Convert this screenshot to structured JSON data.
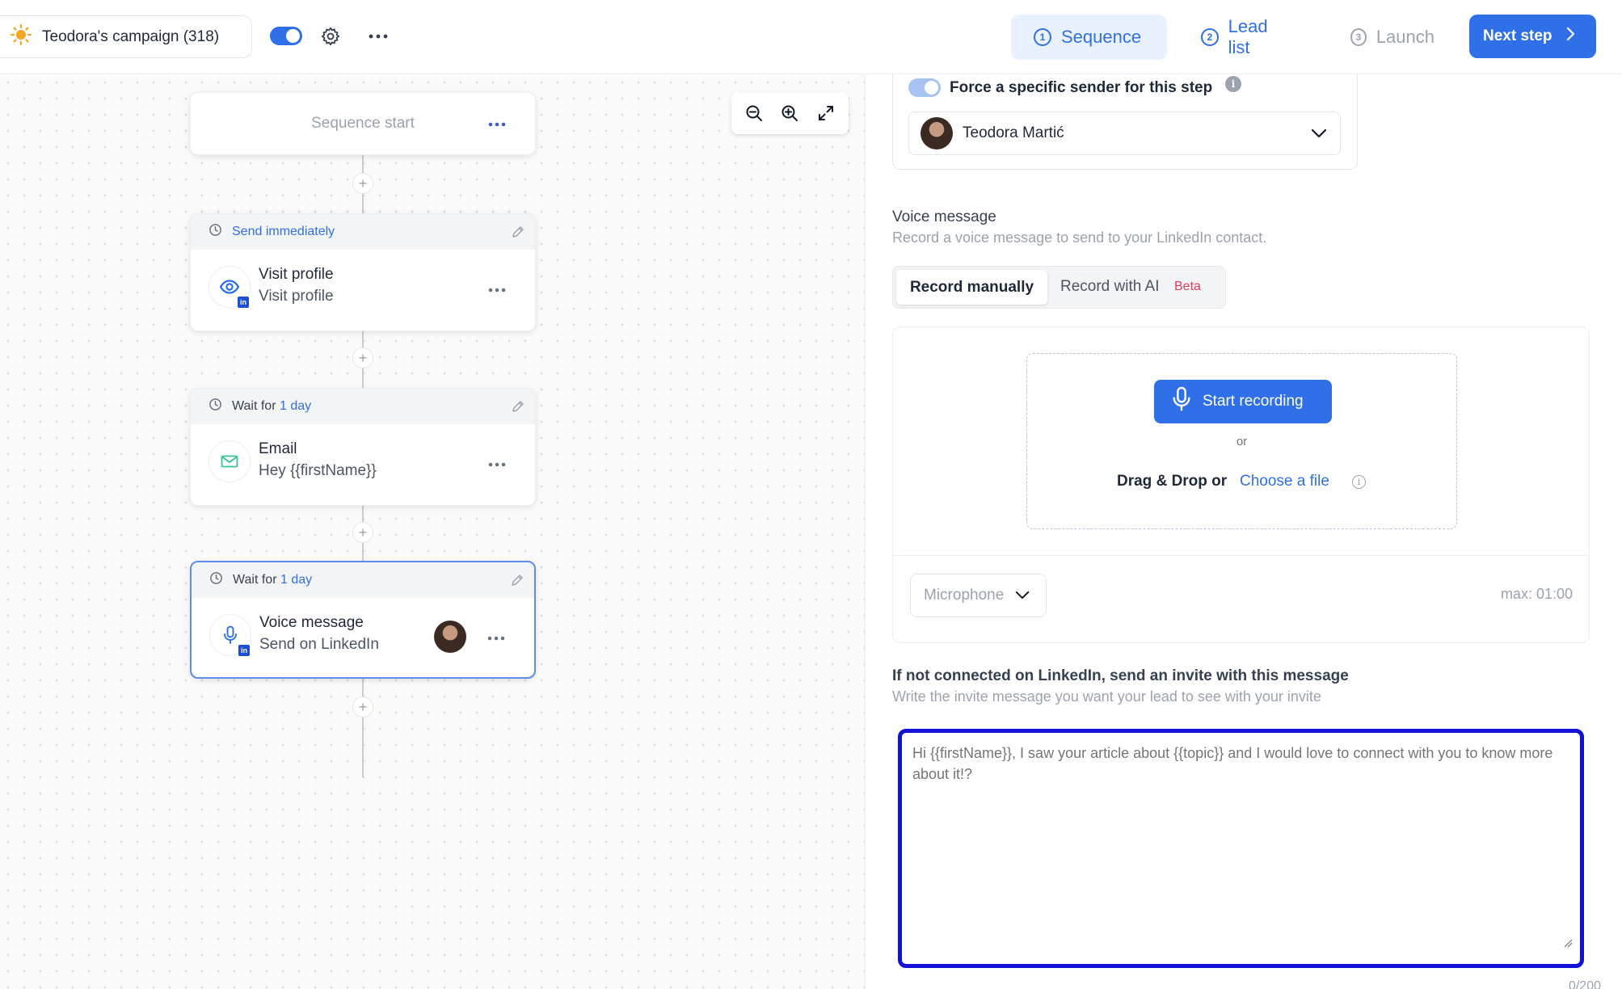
{
  "colors": {
    "accent": "#2f6fe8",
    "accent_light": "#e9f1fe",
    "beta": "#e23b5a",
    "focus_outline": "#1212d6",
    "linkedin": "#1d4ed8",
    "sun": "#f5a623"
  },
  "topbar": {
    "campaign_name": "Teodora's campaign (318)",
    "campaign_icon": "sun-icon",
    "campaign_active": true,
    "tabs": [
      {
        "number": "1",
        "label": "Sequence",
        "state": "active"
      },
      {
        "number": "2",
        "label": "Lead list",
        "state": "done"
      },
      {
        "number": "3",
        "label": "Launch",
        "state": "inactive"
      }
    ],
    "next_label": "Next step"
  },
  "canvas": {
    "start_label": "Sequence start",
    "steps": [
      {
        "delay_label": "Send immediately",
        "delay_value": "",
        "title": "Visit profile",
        "subtitle": "Visit profile",
        "icon": "eye-icon",
        "channel": "linkedin"
      },
      {
        "delay_label": "Wait for",
        "delay_value": "1 day",
        "title": "Email",
        "subtitle": "Hey {{firstName}}",
        "icon": "mail-icon",
        "channel": "email"
      },
      {
        "delay_label": "Wait for",
        "delay_value": "1 day",
        "title": "Voice message",
        "subtitle": "Send on LinkedIn",
        "icon": "microphone-icon",
        "channel": "linkedin",
        "selected": true
      }
    ]
  },
  "panel": {
    "force_sender_label": "Force a specific sender for this step",
    "force_sender_enabled": true,
    "sender_name": "Teodora Martić",
    "voice_title": "Voice message",
    "voice_subtitle": "Record a voice message to send to your LinkedIn contact.",
    "mode_manual": "Record manually",
    "mode_ai": "Record with AI",
    "beta_label": "Beta",
    "start_recording": "Start recording",
    "or_label": "or",
    "drag_drop": "Drag & Drop or",
    "choose_file": "Choose a file",
    "microphone_label": "Microphone",
    "max_duration": "max: 01:00",
    "invite_title": "If not connected on LinkedIn, send an invite with this message",
    "invite_subtitle": "Write the invite message you want your lead to see with your invite",
    "invite_placeholder": "Hi {{firstName}}, I saw your article about {{topic}} and I would love to connect with you to know more about it!?",
    "invite_counter": "0/200"
  }
}
